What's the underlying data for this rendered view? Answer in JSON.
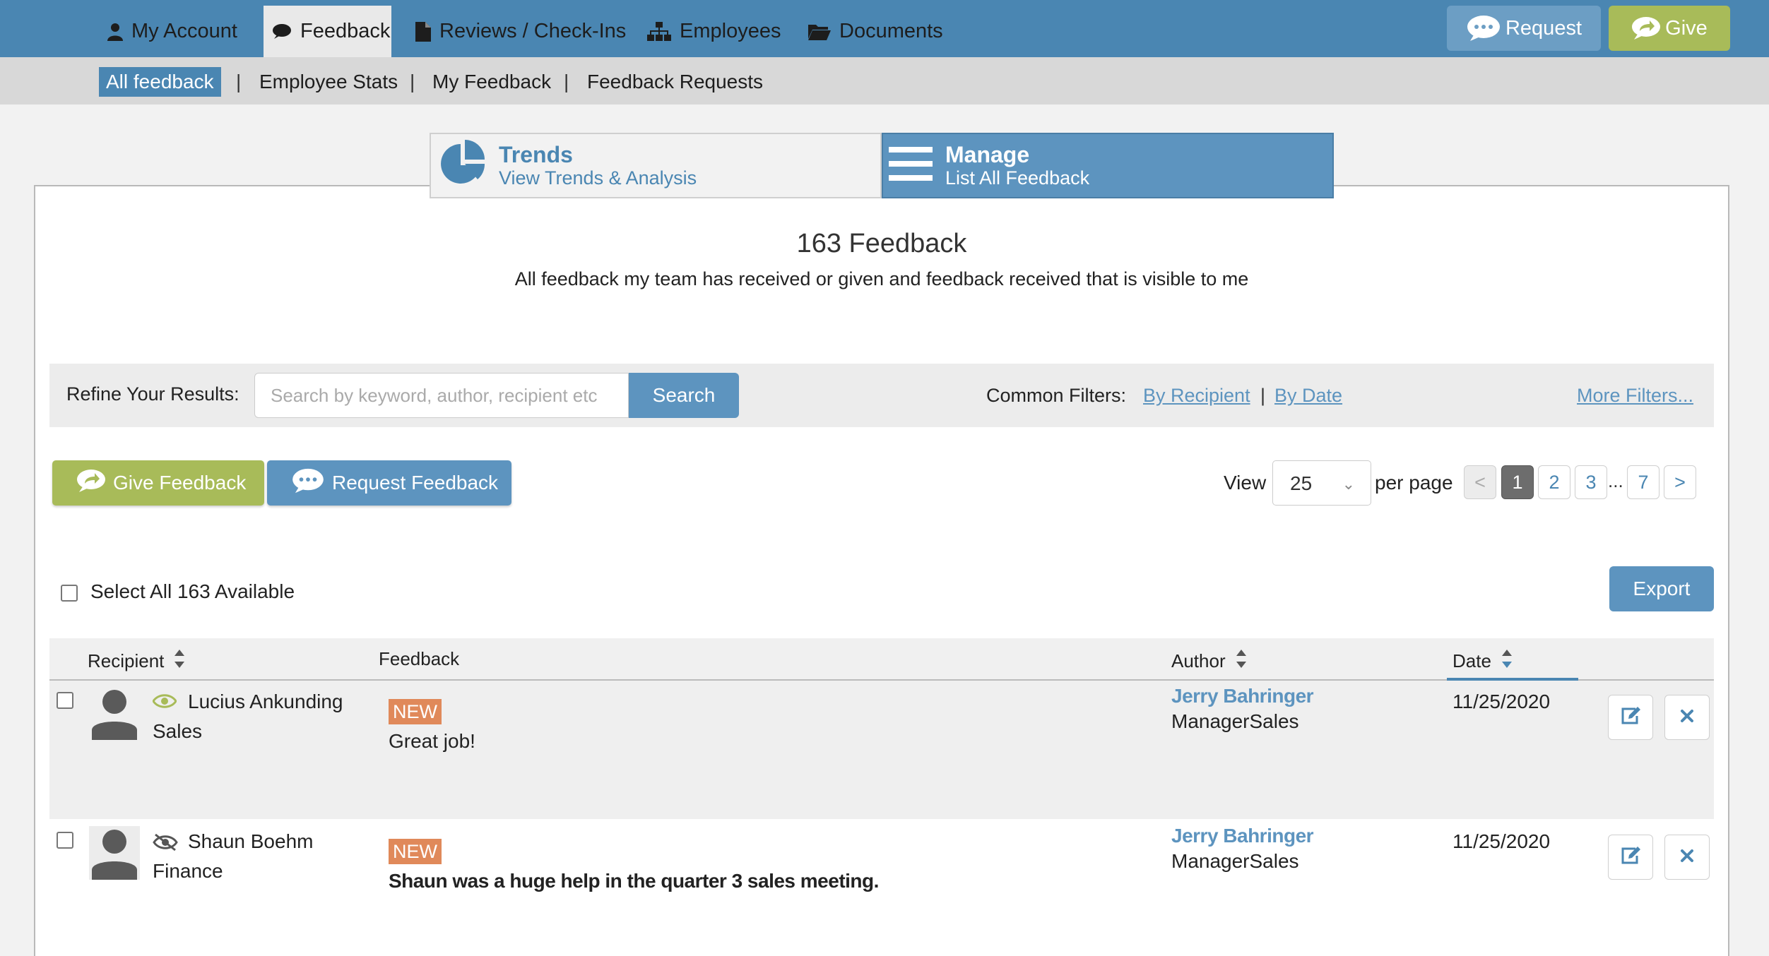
{
  "topnav": {
    "items": [
      {
        "label": "My Account",
        "icon": "user-icon"
      },
      {
        "label": "Feedback",
        "icon": "speech-bubble-icon",
        "active": true
      },
      {
        "label": "Reviews / Check-Ins",
        "icon": "document-icon"
      },
      {
        "label": "Employees",
        "icon": "org-chart-icon"
      },
      {
        "label": "Documents",
        "icon": "folder-icon"
      }
    ],
    "request_label": "Request",
    "give_label": "Give"
  },
  "subnav": {
    "items": [
      {
        "label": "All feedback",
        "active": true
      },
      {
        "label": "Employee Stats"
      },
      {
        "label": "My Feedback"
      },
      {
        "label": "Feedback Requests"
      }
    ],
    "separator": "|"
  },
  "tabs": [
    {
      "title": "Trends",
      "subtitle": "View Trends & Analysis",
      "icon": "pie-chart-icon"
    },
    {
      "title": "Manage",
      "subtitle": "List All Feedback",
      "icon": "list-icon",
      "active": true
    }
  ],
  "panel": {
    "title": "163 Feedback",
    "subtitle": "All feedback my team has received or given and feedback received that is visible to me"
  },
  "refine": {
    "label": "Refine Your Results:",
    "search_placeholder": "Search by keyword, author, recipient etc",
    "search_value": "",
    "search_button": "Search",
    "common_filters_label": "Common Filters:",
    "filters": [
      "By Recipient",
      "By Date"
    ],
    "filter_separator": "|",
    "more_filters": "More Filters..."
  },
  "actions": {
    "give_feedback": "Give Feedback",
    "request_feedback": "Request Feedback"
  },
  "pagination": {
    "view_label": "View",
    "per_page_value": "25",
    "per_page_label": "per page",
    "prev": "<",
    "pages": [
      "1",
      "2",
      "3"
    ],
    "ellipsis": "...",
    "last": "7",
    "next": ">",
    "current_page": "1"
  },
  "select_all_label": "Select All 163 Available",
  "export_label": "Export",
  "table": {
    "headers": {
      "recipient": "Recipient",
      "feedback": "Feedback",
      "author": "Author",
      "date": "Date"
    },
    "rows": [
      {
        "recipient": "Lucius Ankunding",
        "department": "Sales",
        "visibility": "visible",
        "badge": "NEW",
        "feedback": "Great job!",
        "author": "Jerry Bahringer",
        "author_role": "ManagerSales",
        "date": "11/25/2020"
      },
      {
        "recipient": "Shaun Boehm",
        "department": "Finance",
        "visibility": "hidden",
        "badge": "NEW",
        "feedback": "Shaun was a huge help in the quarter 3 sales meeting.",
        "author": "Jerry Bahringer",
        "author_role": "ManagerSales",
        "date": "11/25/2020"
      }
    ]
  },
  "colors": {
    "primary_blue": "#4a86b2",
    "button_blue": "#5d94bf",
    "give_green": "#a8bb59",
    "new_badge": "#e0895a",
    "visible_eye": "#a8bb59"
  }
}
